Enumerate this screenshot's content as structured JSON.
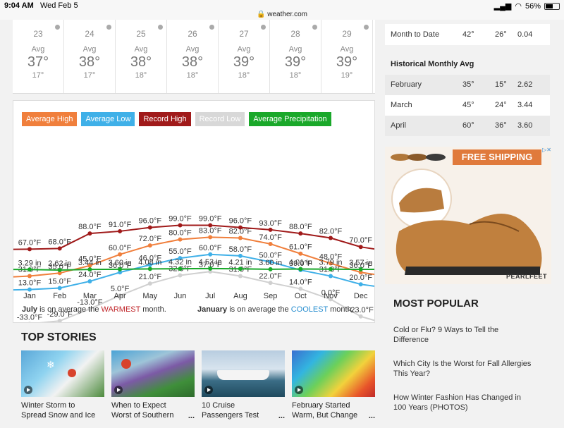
{
  "status": {
    "time": "9:04 AM",
    "date": "Wed Feb 5",
    "url": "weather.com",
    "battery": "56%",
    "battery_level": 0.56
  },
  "days": [
    {
      "num": "23",
      "avg": "Avg",
      "high": "37°",
      "low": "17°"
    },
    {
      "num": "24",
      "avg": "Avg",
      "high": "38°",
      "low": "17°"
    },
    {
      "num": "25",
      "avg": "Avg",
      "high": "38°",
      "low": "18°"
    },
    {
      "num": "26",
      "avg": "Avg",
      "high": "38°",
      "low": "18°"
    },
    {
      "num": "27",
      "avg": "Avg",
      "high": "39°",
      "low": "18°"
    },
    {
      "num": "28",
      "avg": "Avg",
      "high": "39°",
      "low": "18°"
    },
    {
      "num": "29",
      "avg": "Avg",
      "high": "39°",
      "low": "19°"
    }
  ],
  "chart_data": {
    "type": "line",
    "title": "",
    "categories": [
      "Jan",
      "Feb",
      "Mar",
      "Apr",
      "May",
      "Jun",
      "Jul",
      "Aug",
      "Sep",
      "Oct",
      "Nov",
      "Dec"
    ],
    "series": [
      {
        "name": "Average High",
        "color": "#f07f3c",
        "values": [
          31,
          35,
          45,
          60,
          72,
          80,
          83,
          82,
          74,
          61,
          48,
          36
        ],
        "labels": [
          "31.0°F",
          "35.0°F",
          "45.0°F",
          "60.0°F",
          "72.0°F",
          "80.0°F",
          "83.0°F",
          "82.0°F",
          "74.0°F",
          "61.0°F",
          "48.0°F",
          "36.0°F"
        ]
      },
      {
        "name": "Average Low",
        "color": "#3fb0e8",
        "values": [
          13,
          15,
          24,
          36,
          46,
          55,
          60,
          58,
          50,
          39,
          31,
          20
        ],
        "labels": [
          "13.0°F",
          "15.0°F",
          "24.0°F",
          "36.0°F",
          "46.0°F",
          "55.0°F",
          "60.0°F",
          "58.0°F",
          "50.0°F",
          "39.0°F",
          "31.0°F",
          "20.0°F"
        ]
      },
      {
        "name": "Record High",
        "color": "#a01a1a",
        "values": [
          67,
          68,
          88,
          91,
          96,
          99,
          99,
          96,
          93,
          88,
          82,
          70
        ],
        "labels": [
          "67.0°F",
          "68.0°F",
          "88.0°F",
          "91.0°F",
          "96.0°F",
          "99.0°F",
          "99.0°F",
          "96.0°F",
          "93.0°F",
          "88.0°F",
          "82.0°F",
          "70.0°F"
        ]
      },
      {
        "name": "Record Low",
        "color": "#d0d0d0",
        "values": [
          -33,
          -29,
          -13,
          5,
          21,
          32,
          37,
          31,
          22,
          14,
          0,
          -23
        ],
        "labels": [
          "-33.0°F",
          "-29.0°F",
          "-13.0°F",
          "5.0°F",
          "21.0°F",
          "32.0°F",
          "37.0°F",
          "31.0°F",
          "22.0°F",
          "14.0°F",
          "0.0°F",
          "-23.0°F"
        ]
      },
      {
        "name": "Average Precipitation",
        "color": "#1aa82a",
        "values": [
          3.29,
          2.62,
          3.44,
          3.6,
          4.08,
          4.32,
          4.53,
          4.21,
          3.6,
          4.01,
          3.79,
          3.57
        ],
        "labels": [
          "3.29 in",
          "2.62 in",
          "3.44 in",
          "3.60 in",
          "4.08 in",
          "4.32 in",
          "4.53 in",
          "4.21 in",
          "3.60 in",
          "4.01 in",
          "3.79 in",
          "3.57 in"
        ]
      }
    ]
  },
  "legend": [
    "Average High",
    "Average Low",
    "Record High",
    "Record Low",
    "Average Precipitation"
  ],
  "legend_colors": [
    "#f07f3c",
    "#3fb0e8",
    "#a01a1a",
    "#d8d8d8",
    "#1aa82a"
  ],
  "facts": {
    "warm_month": "July",
    "warm_pre": " is on average the ",
    "warm_word": "WARMEST",
    "warm_post": " month.",
    "cold_month": "January",
    "cold_pre": " is on average the ",
    "cold_word": "COOLEST",
    "cold_post": " month."
  },
  "top_stories": {
    "title": "TOP STORIES",
    "items": [
      {
        "line1": "Winter Storm to",
        "line2": "Spread Snow and Ice"
      },
      {
        "line1": "When to Expect",
        "line2": "Worst of Southern"
      },
      {
        "line1": "10 Cruise",
        "line2": "Passengers Test"
      },
      {
        "line1": "February Started",
        "line2": "Warm, But Change"
      }
    ],
    "more": "..."
  },
  "month_to_date": {
    "label": "Month to Date",
    "high": "42°",
    "low": "26°",
    "precip": "0.04"
  },
  "historical": {
    "title": "Historical Monthly Avg",
    "rows": [
      {
        "month": "February",
        "high": "35°",
        "low": "15°",
        "precip": "2.62"
      },
      {
        "month": "March",
        "high": "45°",
        "low": "24°",
        "precip": "3.44"
      },
      {
        "month": "April",
        "high": "60°",
        "low": "36°",
        "precip": "3.60"
      }
    ]
  },
  "ad": {
    "headline": "FREE SHIPPING",
    "brand": "PEARLFEET",
    "tag": "▷✕"
  },
  "most_popular": {
    "title": "MOST POPULAR",
    "items": [
      "Cold or Flu? 9 Ways to Tell the Difference",
      "Which City Is the Worst for Fall Allergies This Year?",
      "How Winter Fashion Has Changed in 100 Years (PHOTOS)"
    ]
  }
}
